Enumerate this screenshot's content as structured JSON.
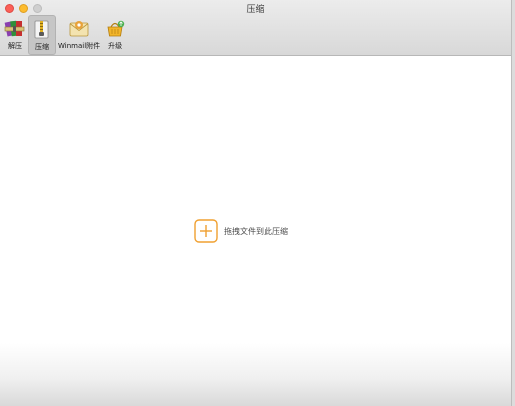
{
  "window": {
    "title": "压缩"
  },
  "toolbar": {
    "items": [
      {
        "label": "解压",
        "icon": "winrar-books-icon",
        "selected": false
      },
      {
        "label": "压缩",
        "icon": "compress-file-icon",
        "selected": true
      },
      {
        "label": "Winmail附件",
        "icon": "mail-envelope-icon",
        "selected": false
      },
      {
        "label": "升级",
        "icon": "upgrade-basket-icon",
        "selected": false
      }
    ]
  },
  "main": {
    "drop_hint": "拖拽文件到此压缩",
    "add_icon": "plus-icon"
  },
  "colors": {
    "accent": "#f0a030",
    "close": "#fc5f57",
    "minimize": "#fdbc2e",
    "maximize": "#cfcfcf"
  }
}
